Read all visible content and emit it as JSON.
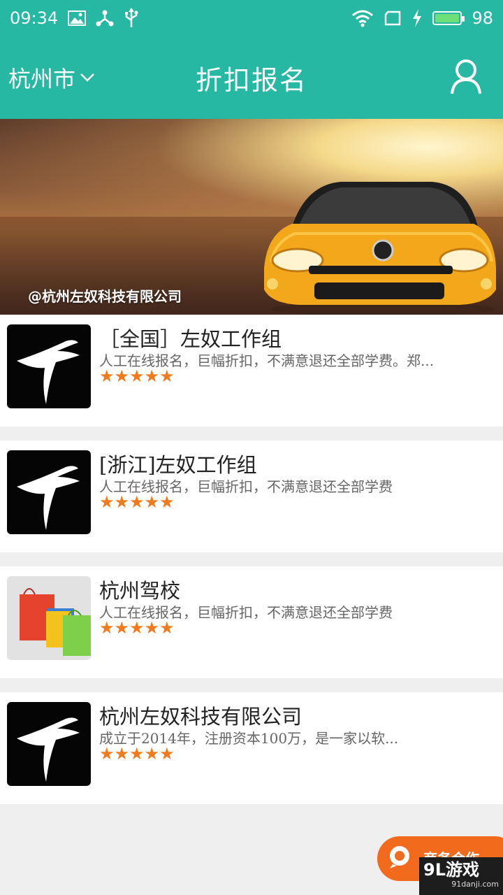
{
  "status_bar": {
    "time": "09:34",
    "battery_level": "98",
    "icons": [
      "image-icon",
      "share-icon",
      "usb-icon",
      "wifi-icon",
      "sim-icon",
      "charging-icon",
      "battery-icon"
    ]
  },
  "app_bar": {
    "city": "杭州市",
    "title": "折扣报名",
    "user_icon": "user-icon"
  },
  "banner": {
    "caption": "@杭州左奴科技有限公司"
  },
  "items": [
    {
      "title": "［全国］左奴工作组",
      "desc": "人工在线报名，巨幅折扣，不满意退还全部学费。郑...",
      "rating": 5,
      "thumb": "logo"
    },
    {
      "title": "[浙江]左奴工作组",
      "desc": "人工在线报名，巨幅折扣，不满意退还全部学费",
      "rating": 5,
      "thumb": "logo"
    },
    {
      "title": "杭州驾校",
      "desc": "人工在线报名，巨幅折扣，不满意退还全部学费",
      "rating": 5,
      "thumb": "bags"
    },
    {
      "title": "杭州左奴科技有限公司",
      "desc": "成立于2014年，注册资本100万，是一家以软...",
      "rating": 5,
      "thumb": "logo"
    }
  ],
  "float_button": {
    "label": "商务合作"
  },
  "watermark": {
    "main": "9L游戏",
    "sub": "91danji.com"
  },
  "colors": {
    "primary": "#26b8a3",
    "star": "#f07a1c",
    "float": "#f26a1b"
  }
}
